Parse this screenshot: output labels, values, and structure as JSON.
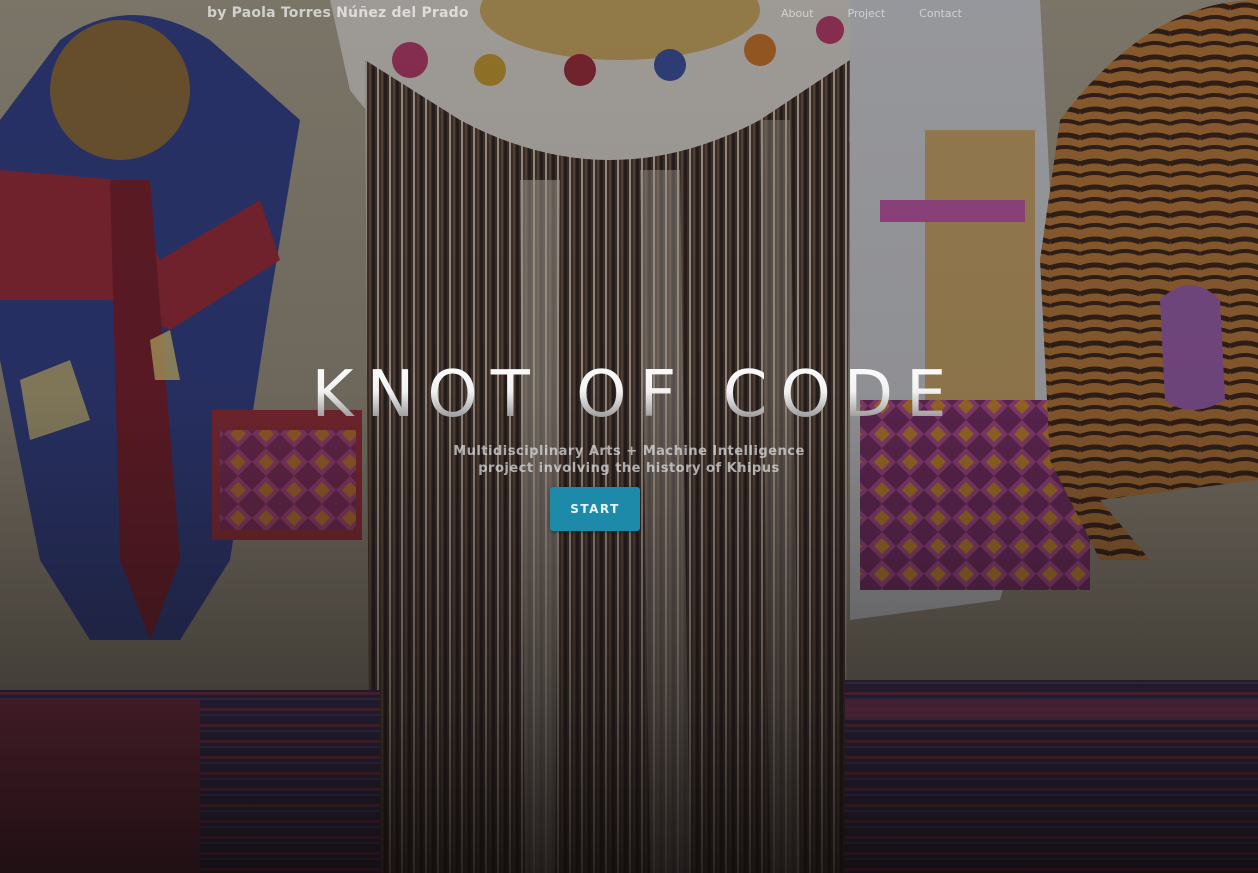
{
  "brand": {
    "text": "by Paola Torres Núñez del Prado"
  },
  "nav": {
    "items": [
      {
        "label": "About"
      },
      {
        "label": "Project"
      },
      {
        "label": "Contact"
      }
    ]
  },
  "hero": {
    "title": "KNOT OF CODE",
    "subtitle_line1": "Multidisciplinary Arts + Machine Intelligence",
    "subtitle_line2": "project involving the history of Khipus",
    "cta_label": "START",
    "accent_color": "#1c8aa8"
  }
}
